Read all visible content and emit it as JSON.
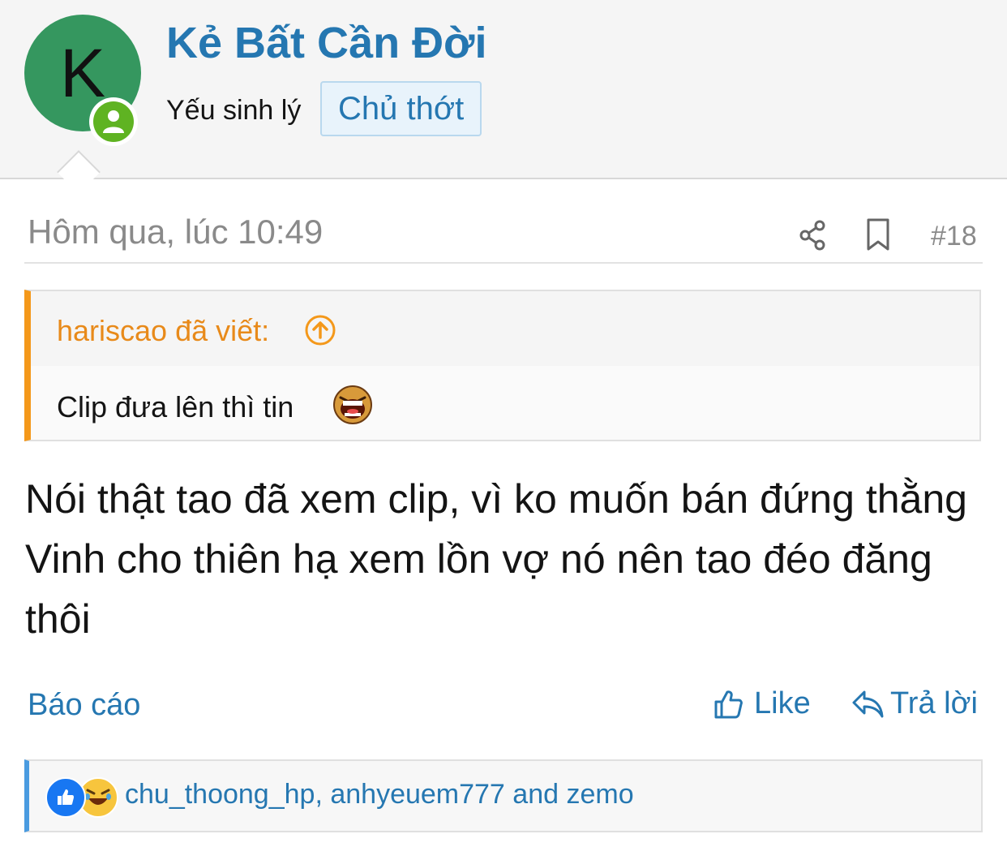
{
  "author": {
    "avatar_letter": "K",
    "name": "Kẻ Bất Cần Đời",
    "title": "Yếu sinh lý",
    "badge": "Chủ thớt",
    "avatar_color": "#35975f",
    "status_color": "#5fb322"
  },
  "meta": {
    "time": "Hôm qua, lúc 10:49",
    "post_number": "#18"
  },
  "quote": {
    "author": "hariscao đã viết:",
    "text": "Clip đưa lên thì tin",
    "accent_color": "#f4981a"
  },
  "message": "Nói thật tao đã xem clip, vì ko muốn bán đứng thằng Vinh cho thiên hạ xem lồn vợ nó nên tao đéo đăng thôi",
  "actions": {
    "report": "Báo cáo",
    "like": "Like",
    "reply": "Trả lời"
  },
  "reactions": {
    "names": "chu_thoong_hp, anhyeuem777 and zemo"
  },
  "colors": {
    "link": "#2577b1",
    "muted": "#8a8a8a"
  }
}
